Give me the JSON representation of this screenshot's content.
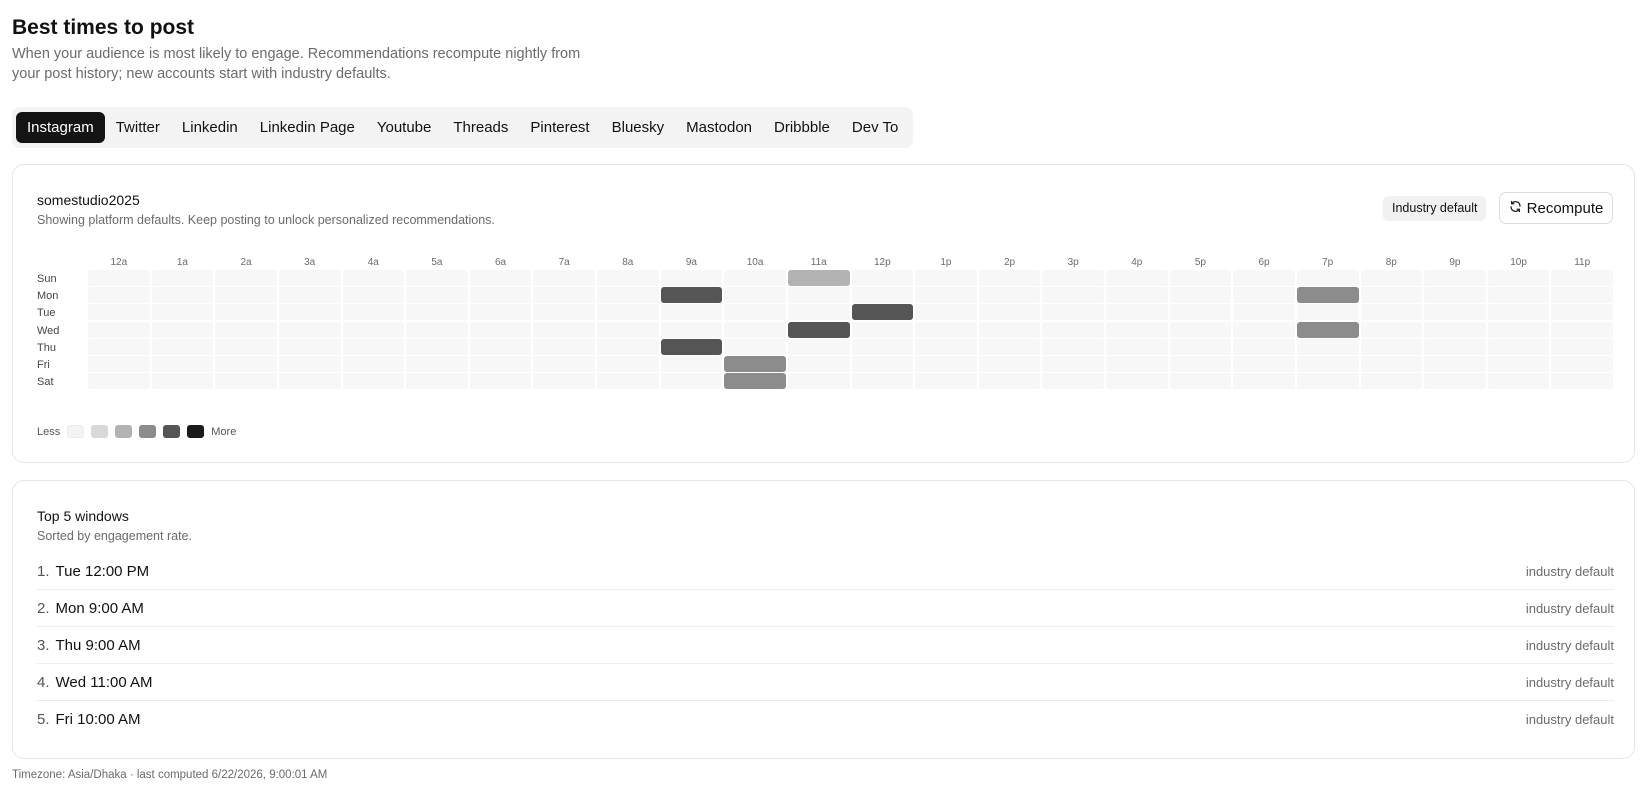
{
  "header": {
    "title": "Best times to post",
    "subtitle": "When your audience is most likely to engage. Recommendations recompute nightly from your post history; new accounts start with industry defaults."
  },
  "tabs": [
    {
      "label": "Instagram",
      "active": true
    },
    {
      "label": "Twitter",
      "active": false
    },
    {
      "label": "Linkedin",
      "active": false
    },
    {
      "label": "Linkedin Page",
      "active": false
    },
    {
      "label": "Youtube",
      "active": false
    },
    {
      "label": "Threads",
      "active": false
    },
    {
      "label": "Pinterest",
      "active": false
    },
    {
      "label": "Bluesky",
      "active": false
    },
    {
      "label": "Mastodon",
      "active": false
    },
    {
      "label": "Dribbble",
      "active": false
    },
    {
      "label": "Dev To",
      "active": false
    }
  ],
  "heatmap_card": {
    "account": "somestudio2025",
    "note": "Showing platform defaults. Keep posting to unlock personalized recommendations.",
    "badge": "Industry default",
    "recompute_label": "Recompute",
    "hours": [
      "12a",
      "1a",
      "2a",
      "3a",
      "4a",
      "5a",
      "6a",
      "7a",
      "8a",
      "9a",
      "10a",
      "11a",
      "12p",
      "1p",
      "2p",
      "3p",
      "4p",
      "5p",
      "6p",
      "7p",
      "8p",
      "9p",
      "10p",
      "11p"
    ],
    "days": [
      "Sun",
      "Mon",
      "Tue",
      "Wed",
      "Thu",
      "Fri",
      "Sat"
    ],
    "highlights": [
      {
        "day": "Sun",
        "hour": "11a",
        "level": 1
      },
      {
        "day": "Mon",
        "hour": "9a",
        "level": 3
      },
      {
        "day": "Mon",
        "hour": "7p",
        "level": 2
      },
      {
        "day": "Tue",
        "hour": "12p",
        "level": 3
      },
      {
        "day": "Wed",
        "hour": "11a",
        "level": 3
      },
      {
        "day": "Wed",
        "hour": "7p",
        "level": 2
      },
      {
        "day": "Thu",
        "hour": "9a",
        "level": 3
      },
      {
        "day": "Fri",
        "hour": "10a",
        "level": 2
      },
      {
        "day": "Sat",
        "hour": "10a",
        "level": 2
      }
    ],
    "legend": {
      "less": "Less",
      "more": "More",
      "colors": [
        "#f4f4f4",
        "#d9d9d9",
        "#b3b3b3",
        "#8c8c8c",
        "#555555",
        "#1a1a1a"
      ]
    }
  },
  "top_windows": {
    "title": "Top 5 windows",
    "note": "Sorted by engagement rate.",
    "items": [
      {
        "rank": "1.",
        "time": "Tue 12:00 PM",
        "source": "industry default"
      },
      {
        "rank": "2.",
        "time": "Mon 9:00 AM",
        "source": "industry default"
      },
      {
        "rank": "3.",
        "time": "Thu 9:00 AM",
        "source": "industry default"
      },
      {
        "rank": "4.",
        "time": "Wed 11:00 AM",
        "source": "industry default"
      },
      {
        "rank": "5.",
        "time": "Fri 10:00 AM",
        "source": "industry default"
      }
    ]
  },
  "footer": {
    "text": "Timezone: Asia/Dhaka · last computed 6/22/2026, 9:00:01 AM"
  }
}
